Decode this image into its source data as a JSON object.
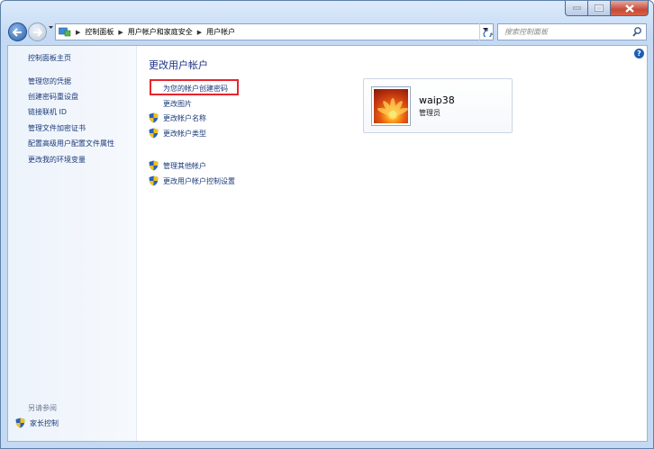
{
  "window": {
    "title": ""
  },
  "address_bar": {
    "breadcrumbs": [
      "控制面板",
      "用户帐户和家庭安全",
      "用户帐户"
    ]
  },
  "search": {
    "placeholder": "搜索控制面板"
  },
  "sidebar": {
    "home": "控制面板主页",
    "links": [
      "管理您的凭据",
      "创建密码重设盘",
      "链接联机 ID",
      "管理文件加密证书",
      "配置高级用户配置文件属性",
      "更改我的环境变量"
    ],
    "see_also_title": "另请参阅",
    "see_also_links": [
      "家长控制"
    ]
  },
  "main": {
    "title": "更改用户帐户",
    "tasks": [
      {
        "label": "为您的帐户创建密码",
        "shield": false,
        "highlighted": true
      },
      {
        "label": "更改图片",
        "shield": false
      },
      {
        "label": "更改帐户名称",
        "shield": true
      },
      {
        "label": "更改帐户类型",
        "shield": true
      }
    ],
    "other_tasks": [
      {
        "label": "管理其他帐户",
        "shield": true
      },
      {
        "label": "更改用户帐户控制设置",
        "shield": true
      }
    ]
  },
  "user": {
    "name": "waip38",
    "role": "管理员"
  },
  "colors": {
    "highlight_box": "#e8252c",
    "link": "#1a3a7a",
    "title": "#1e3287"
  }
}
